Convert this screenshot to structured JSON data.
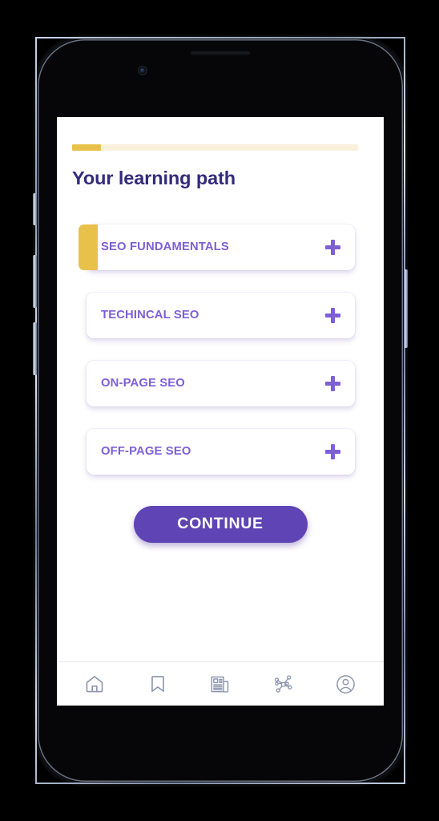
{
  "device": {
    "name": "smartphone-mockup",
    "earpiece": "speaker-slot",
    "camera": "front-camera",
    "buttons": [
      "mute-switch",
      "volume-up",
      "volume-down",
      "power"
    ]
  },
  "colors": {
    "accent_purple": "#7d5fd6",
    "primary_purple": "#5f44b5",
    "title_indigo": "#332b7a",
    "accent_yellow": "#e8c14b",
    "progress_track": "#faf1dd",
    "nav_icon": "#8d96ae",
    "screen_bg": "#ffffff"
  },
  "screen": {
    "progress": {
      "name": "learning-progress",
      "percent": 10,
      "fill_color": "#e8c14b",
      "track_color": "#faf1dd"
    },
    "title": "Your learning path",
    "modules": [
      {
        "label": "SEO FUNDAMENTALS",
        "expand_icon": "plus-icon",
        "accent": true
      },
      {
        "label": "TECHINCAL SEO",
        "expand_icon": "plus-icon",
        "accent": false
      },
      {
        "label": "ON-PAGE SEO",
        "expand_icon": "plus-icon",
        "accent": false
      },
      {
        "label": "OFF-PAGE SEO",
        "expand_icon": "plus-icon",
        "accent": false
      }
    ],
    "continue_label": "CONTINUE",
    "bottom_nav": [
      {
        "icon": "home-icon",
        "label": "Home"
      },
      {
        "icon": "bookmark-icon",
        "label": "Bookmarks"
      },
      {
        "icon": "news-icon",
        "label": "News"
      },
      {
        "icon": "network-icon",
        "label": "Network"
      },
      {
        "icon": "profile-icon",
        "label": "Profile"
      }
    ]
  }
}
